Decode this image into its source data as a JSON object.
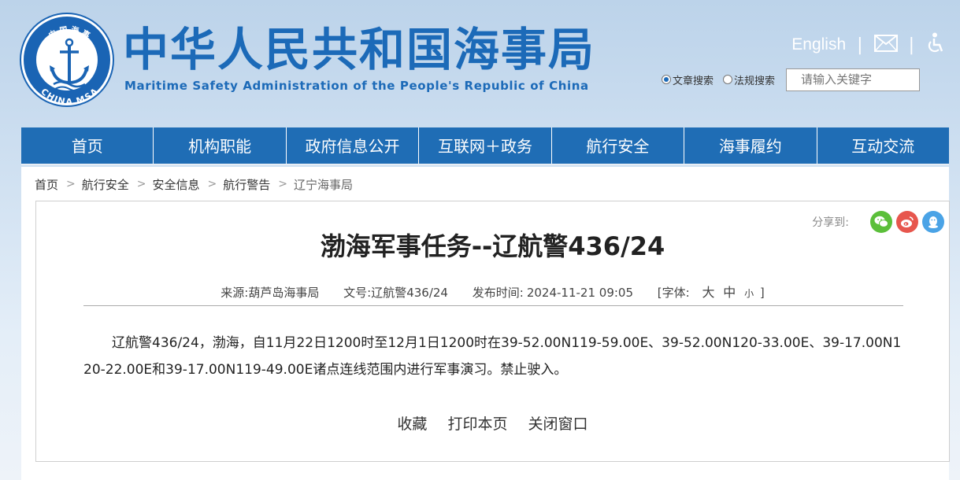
{
  "header": {
    "logo": {
      "ring_top": "中 国 海 事",
      "ring_bottom": "CHINA MSA"
    },
    "title_cn": "中华人民共和国海事局",
    "title_en": "Maritime Safety Administration of the People's Republic of China",
    "english_link": "English",
    "separator": "|",
    "mail_icon": "mail-icon",
    "accessibility_icon": "accessibility-icon"
  },
  "search": {
    "option_article": "文章搜索",
    "option_regulation": "法规搜索",
    "selected": "文章搜索",
    "placeholder": "请输入关键字"
  },
  "nav": {
    "items": [
      "首页",
      "机构职能",
      "政府信息公开",
      "互联网＋政务",
      "航行安全",
      "海事履约",
      "互动交流"
    ]
  },
  "breadcrumb": {
    "items": [
      "首页",
      "航行安全",
      "安全信息",
      "航行警告",
      "辽宁海事局"
    ],
    "separator": ">"
  },
  "article": {
    "share_label": "分享到:",
    "share_icons": [
      "wechat-icon",
      "weibo-icon",
      "qq-icon"
    ],
    "title": "渤海军事任务--辽航警436/24",
    "source_label": "来源:",
    "source": "葫芦岛海事局",
    "doc_no_label": "文号:",
    "doc_no": "辽航警436/24",
    "publish_label": "发布时间:",
    "publish_time": "2024-11-21 09:05",
    "font_label": "[字体:",
    "font_large": "大",
    "font_medium": "中",
    "font_small": "小",
    "font_close": "]",
    "body": "辽航警436/24，渤海，自11月22日1200时至12月1日1200时在39-52.00N119-59.00E、39-52.00N120-33.00E、39-17.00N120-22.00E和39-17.00N119-49.00E诸点连线范围内进行军事演习。禁止驶入。",
    "action_favorite": "收藏",
    "action_print": "打印本页",
    "action_close": "关闭窗口"
  },
  "colors": {
    "brand_blue": "#1f6db5",
    "title_blue": "#1c6ab8",
    "wechat": "#5bbf3a",
    "weibo": "#e7564d",
    "qq": "#4aa3e6"
  }
}
